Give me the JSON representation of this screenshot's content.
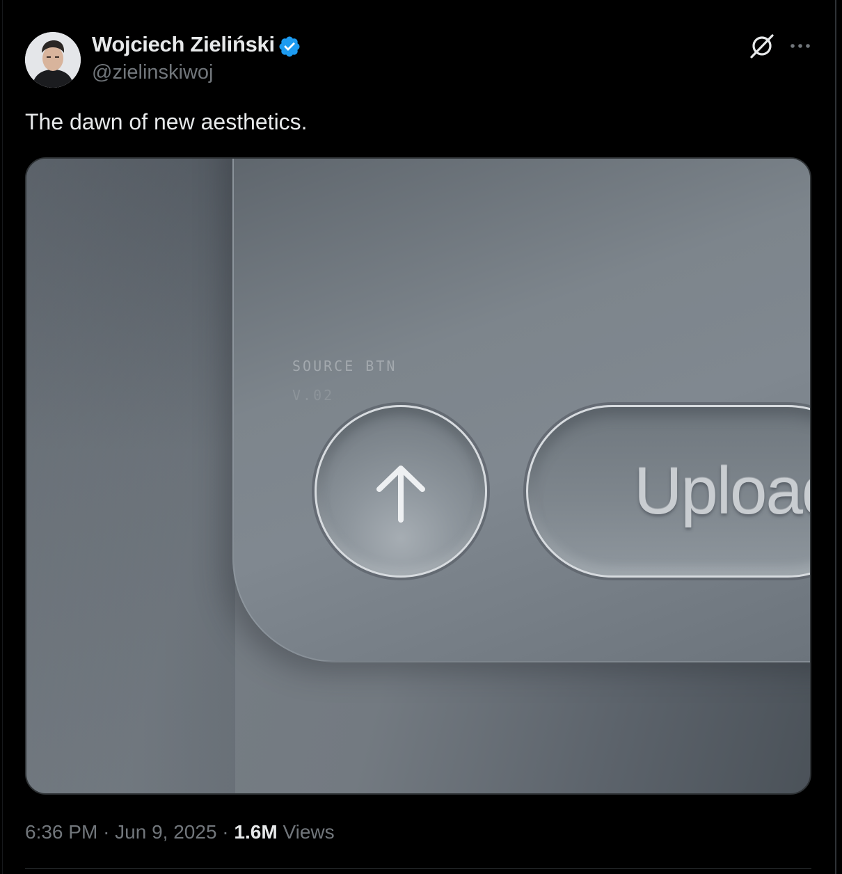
{
  "tweet": {
    "author_name": "Wojciech Zieliński",
    "author_handle": "@zielinskiwoj",
    "text": "The dawn of new aesthetics.",
    "time": "6:36 PM",
    "date": "Jun 9, 2025",
    "views_count": "1.6M",
    "views_label": "Views",
    "separator": "·"
  },
  "icons": {
    "verified": "verified-badge-icon",
    "grok": "grok-icon",
    "more": "more-icon"
  },
  "media": {
    "panel_label": "SOURCE BTN",
    "panel_version": "V.02",
    "upload_button_label": "Upload",
    "arrow_icon": "arrow-up-icon"
  },
  "colors": {
    "background": "#000000",
    "text_primary": "#e7e9ea",
    "text_secondary": "#71767b",
    "verified_blue": "#1d9bf0",
    "divider": "#2f3336"
  }
}
